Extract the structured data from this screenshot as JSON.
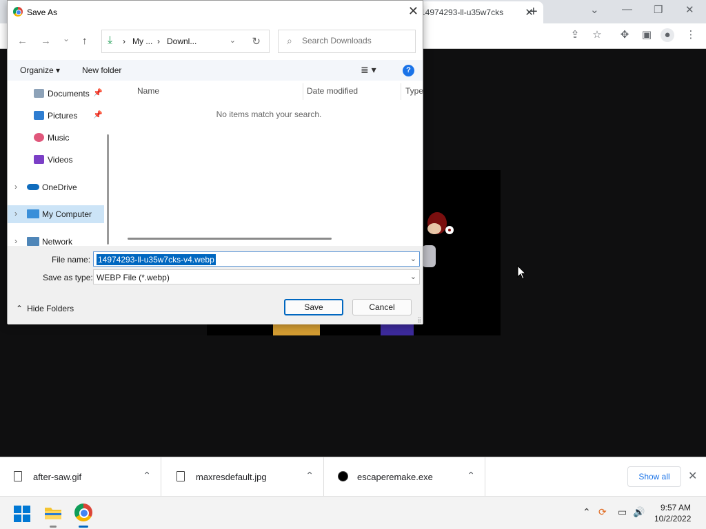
{
  "browser": {
    "tab_title": "14974293-ll-u35w7cks",
    "tab_close": "✕",
    "new_tab": "+",
    "min": "—",
    "max": "❐",
    "close": "✕",
    "chevron": "⌄"
  },
  "dialog": {
    "title": "Save As",
    "close": "✕",
    "back": "←",
    "forward": "→",
    "recent": "⌄",
    "up": "↑",
    "breadcrumb": [
      "My ...",
      "Downl..."
    ],
    "sep": "›",
    "refresh": "↻",
    "search_placeholder": "Search Downloads",
    "organize": "Organize ▾",
    "new_folder": "New folder",
    "view": "≣ ▾",
    "help": "?",
    "nav_items": [
      {
        "label": "Documents",
        "pinned": true
      },
      {
        "label": "Pictures",
        "pinned": true
      },
      {
        "label": "Music",
        "pinned": false
      },
      {
        "label": "Videos",
        "pinned": false
      },
      {
        "label": "OneDrive",
        "pinned": false
      },
      {
        "label": "My Computer",
        "pinned": false
      },
      {
        "label": "Network",
        "pinned": false
      }
    ],
    "pin": "📌",
    "expand": "›",
    "columns": {
      "name": "Name",
      "date": "Date modified",
      "type": "Type"
    },
    "empty_message": "No items match your search.",
    "file_name_label": "File name:",
    "file_name_value": "14974293-ll-u35w7cks-v4.webp",
    "save_type_label": "Save as type:",
    "save_type_value": "WEBP File (*.webp)",
    "hide_folders": "Hide Folders",
    "save": "Save",
    "cancel": "Cancel"
  },
  "downloads": {
    "items": [
      {
        "name": "after-saw.gif"
      },
      {
        "name": "maxresdefault.jpg"
      },
      {
        "name": "escaperemake.exe"
      }
    ],
    "expand": "⌃",
    "show_all": "Show all",
    "close": "✕"
  },
  "taskbar": {
    "time": "9:57 AM",
    "date": "10/2/2022",
    "tray_chevron": "⌃",
    "volume": "🔊"
  }
}
